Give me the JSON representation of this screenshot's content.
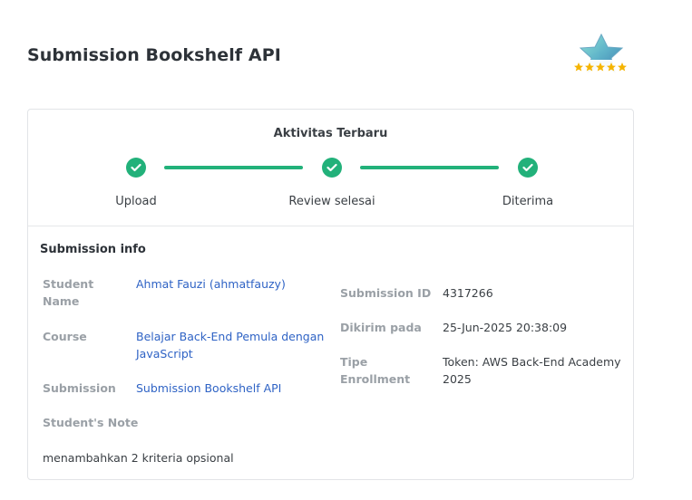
{
  "page": {
    "title": "Submission Bookshelf API"
  },
  "badge": {
    "icon": "star-rating-badge-icon",
    "stars": 5
  },
  "activity": {
    "title": "Aktivitas Terbaru",
    "steps": [
      {
        "label": "Upload",
        "status": "done"
      },
      {
        "label": "Review selesai",
        "status": "done"
      },
      {
        "label": "Diterima",
        "status": "done"
      }
    ],
    "accent_color": "#22b17a"
  },
  "info": {
    "title": "Submission info",
    "student_name_label_1": "Student",
    "student_name_label_2": "Name",
    "student_name_value": "Ahmat Fauzi (ahmatfauzy)",
    "course_label": "Course",
    "course_value_1": "Belajar Back-End Pemula dengan",
    "course_value_2": "JavaScript",
    "submission_label": "Submission",
    "submission_value": "Submission Bookshelf API",
    "note_label": "Student's Note",
    "note_value": "menambahkan 2 kriteria opsional",
    "submission_id_label": "Submission ID",
    "submission_id_value": "4317266",
    "sent_label": "Dikirim pada",
    "sent_value": "25-Jun-2025 20:38:09",
    "enroll_label_1": "Tipe",
    "enroll_label_2": "Enrollment",
    "enroll_value_1": "Token: AWS Back-End Academy",
    "enroll_value_2": "2025",
    "link_color": "#2f63c5"
  }
}
